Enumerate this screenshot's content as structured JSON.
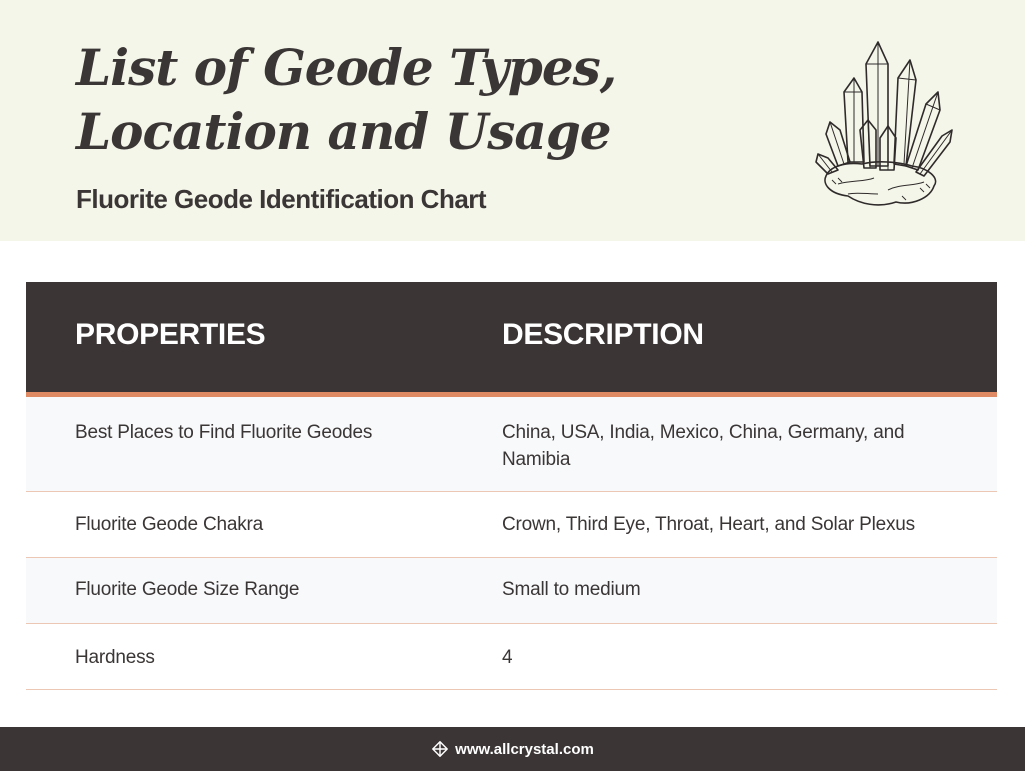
{
  "header": {
    "title": "List of Geode Types, Location and Usage",
    "subtitle": "Fluorite Geode Identification Chart",
    "illustration_icon": "crystal-cluster-illustration"
  },
  "table": {
    "columns": [
      "PROPERTIES",
      "DESCRIPTION"
    ],
    "rows": [
      {
        "property": "Best Places to Find Fluorite Geodes",
        "description": "China, USA, India, Mexico, China, Germany, and Namibia"
      },
      {
        "property": "Fluorite Geode Chakra",
        "description": "Crown, Third Eye, Throat, Heart, and Solar Plexus"
      },
      {
        "property": "Fluorite Geode Size Range",
        "description": "Small to medium"
      },
      {
        "property": "Hardness",
        "description": "4"
      }
    ]
  },
  "footer": {
    "logo_icon": "crystal-logo-icon",
    "url": "www.allcrystal.com"
  },
  "colors": {
    "header_bg": "#f5f6ea",
    "table_header_bg": "#3b3535",
    "accent": "#df8a62",
    "alt_row_bg": "#f8f9fb",
    "divider": "#ecc7b3",
    "text": "#3b3636"
  }
}
